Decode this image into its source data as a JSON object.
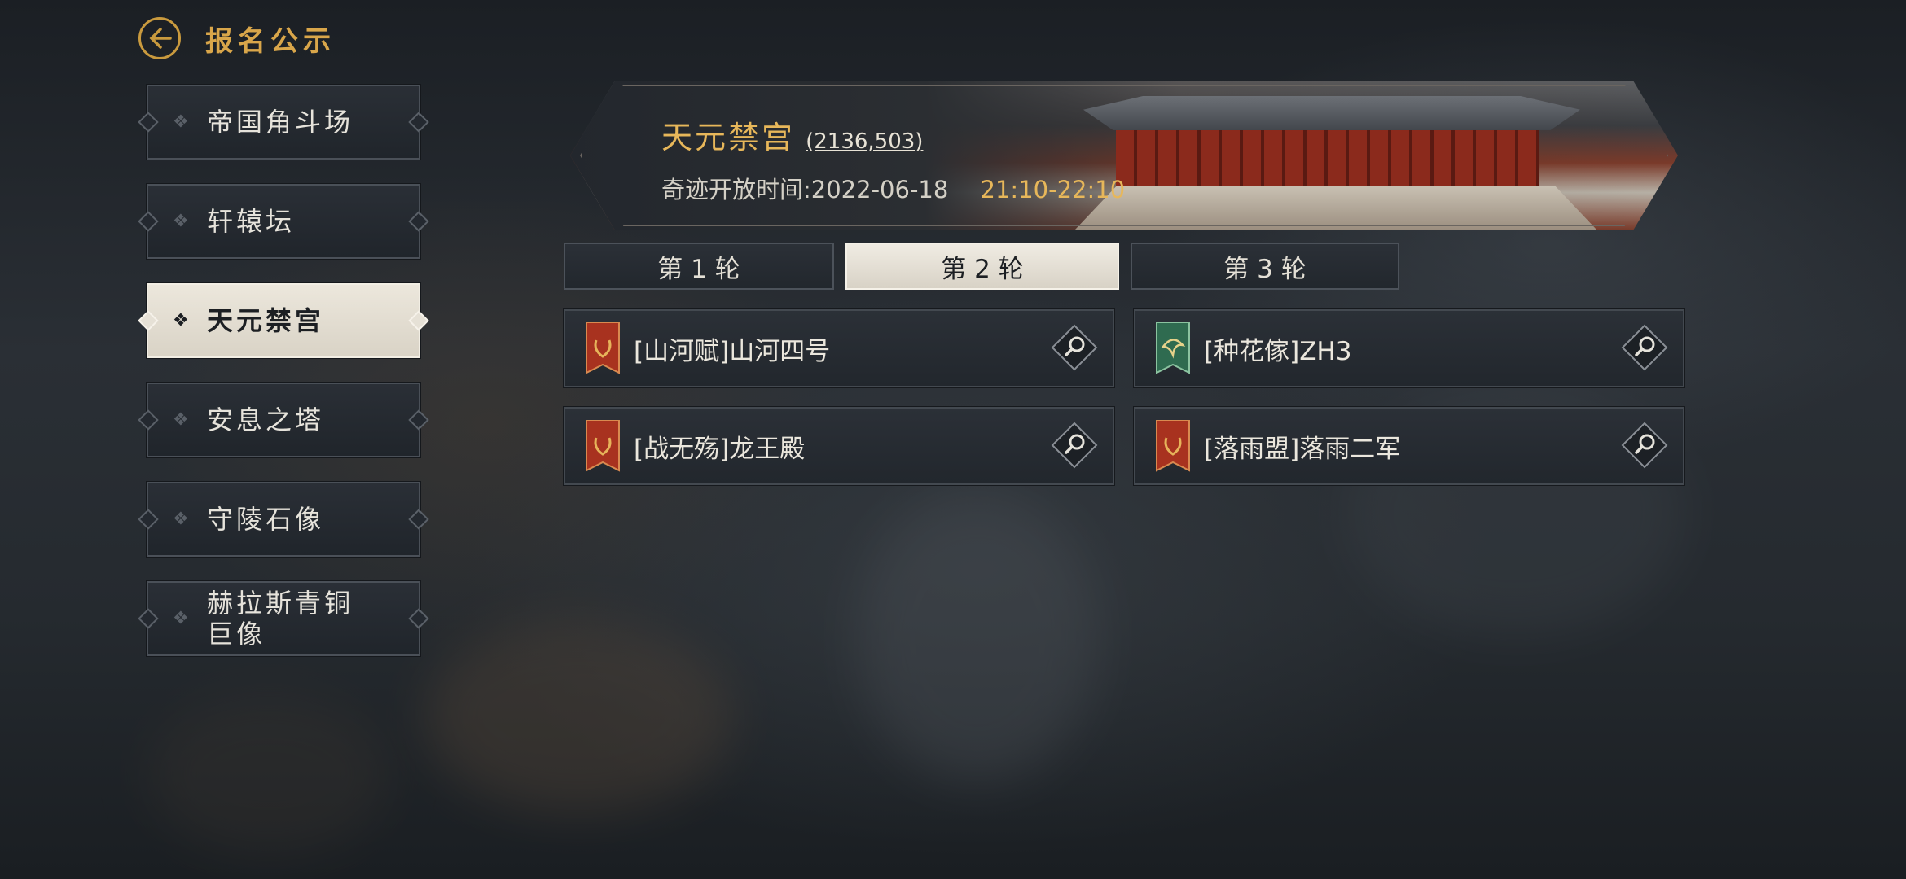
{
  "header": {
    "back_icon": "arrow-left-icon",
    "title": "报名公示"
  },
  "sidebar": {
    "items": [
      {
        "label": "帝国角斗场",
        "active": false
      },
      {
        "label": "轩辕坛",
        "active": false
      },
      {
        "label": "天元禁宫",
        "active": true
      },
      {
        "label": "安息之塔",
        "active": false
      },
      {
        "label": "守陵石像",
        "active": false
      },
      {
        "label": "赫拉斯青铜巨像",
        "active": false
      }
    ]
  },
  "banner": {
    "title": "天元禁宫",
    "coords": "(2136,503)",
    "time_label": "奇迹开放时间:2022-06-18",
    "time_range": "21:10-22:10"
  },
  "rounds": {
    "tabs": [
      "第 1 轮",
      "第 2 轮",
      "第 3 轮"
    ],
    "active_index": 1
  },
  "entries": [
    {
      "name": "[山河赋]山河四号",
      "emblem": "laurel-banner-icon",
      "color": "#a8321f"
    },
    {
      "name": "[种花傢]ZH3",
      "emblem": "phoenix-banner-icon",
      "color": "#2f6b50"
    },
    {
      "name": "[战无殇]龙王殿",
      "emblem": "laurel-banner-icon",
      "color": "#a8321f"
    },
    {
      "name": "[落雨盟]落雨二军",
      "emblem": "laurel-banner-icon",
      "color": "#a8321f"
    }
  ],
  "colors": {
    "accent_gold": "#d9a64a",
    "time_gold": "#e7b75a"
  }
}
